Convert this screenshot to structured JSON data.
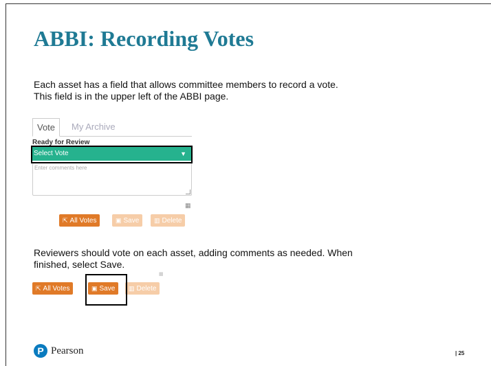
{
  "slide": {
    "title": "ABBI: Recording Votes",
    "paragraph1": "Each asset has a field that allows committee members to record a vote. This field is in the upper left of the ABBI page.",
    "paragraph2": "Reviewers should vote on each asset, adding comments as needed. When finished, select Save.",
    "page_number": "| 25",
    "logo_text": "Pearson",
    "logo_letter": "P"
  },
  "widget": {
    "tabs": [
      {
        "label": "Vote",
        "active": true
      },
      {
        "label": "My Archive",
        "active": false
      }
    ],
    "status_label": "Ready for Review",
    "select_value": "Select Vote",
    "comments_placeholder": "Enter comments here",
    "buttons": {
      "all_votes": "All Votes",
      "save": "Save",
      "delete": "Delete"
    }
  },
  "lower_buttons": {
    "all_votes": "All Votes",
    "save": "Save",
    "delete": "Delete"
  },
  "colors": {
    "title": "#1f7a94",
    "select_bg": "#26b28e",
    "button_orange": "#e07a28",
    "button_faded": "#f6cda8",
    "logo_blue": "#0a7bbf"
  }
}
